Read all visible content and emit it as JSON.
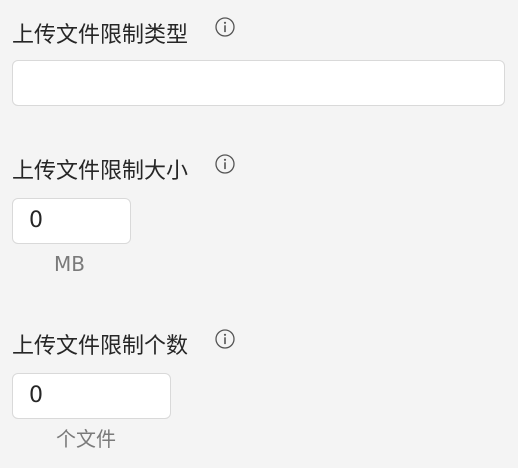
{
  "upload_type": {
    "label": "上传文件限制类型",
    "value": ""
  },
  "upload_size": {
    "label": "上传文件限制大小",
    "value": "0",
    "unit": "MB"
  },
  "upload_count": {
    "label": "上传文件限制个数",
    "value": "0",
    "unit": "个文件"
  },
  "icons": {
    "info": "info-circle-icon"
  },
  "colors": {
    "background": "#f4f4f4",
    "input_border": "#d9d9d9",
    "text": "#262626",
    "unit_text": "#7a7a7a"
  }
}
